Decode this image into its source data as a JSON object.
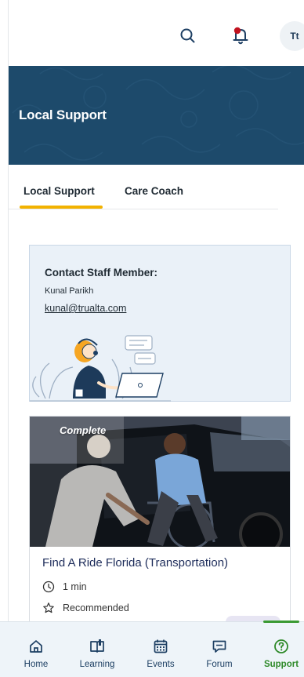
{
  "header": {
    "search_icon": "search-icon",
    "notification_icon": "bell-icon",
    "notification_dot_color": "#c1121f",
    "avatar_initials": "Tt"
  },
  "banner": {
    "title": "Local Support",
    "background_color": "#1d4a6b"
  },
  "tabs": [
    {
      "label": "Local Support",
      "active": true
    },
    {
      "label": "Care Coach",
      "active": false
    }
  ],
  "contact_card": {
    "heading": "Contact Staff Member:",
    "name": "Kunal Parikh",
    "email": "kunal@trualta.com"
  },
  "resource_card": {
    "status_tag": "Complete",
    "title": "Find A Ride Florida (Transportation)",
    "duration": "1 min",
    "recommendation": "Recommended"
  },
  "bottom_nav": {
    "items": [
      {
        "label": "Home",
        "icon": "home-icon"
      },
      {
        "label": "Learning",
        "icon": "book-icon"
      },
      {
        "label": "Events",
        "icon": "calendar-icon"
      },
      {
        "label": "Forum",
        "icon": "chat-icon"
      },
      {
        "label": "Support",
        "icon": "help-circle-icon",
        "active": true
      }
    ],
    "active_color": "#2f8a2a",
    "accent_color": "#f2b200"
  }
}
